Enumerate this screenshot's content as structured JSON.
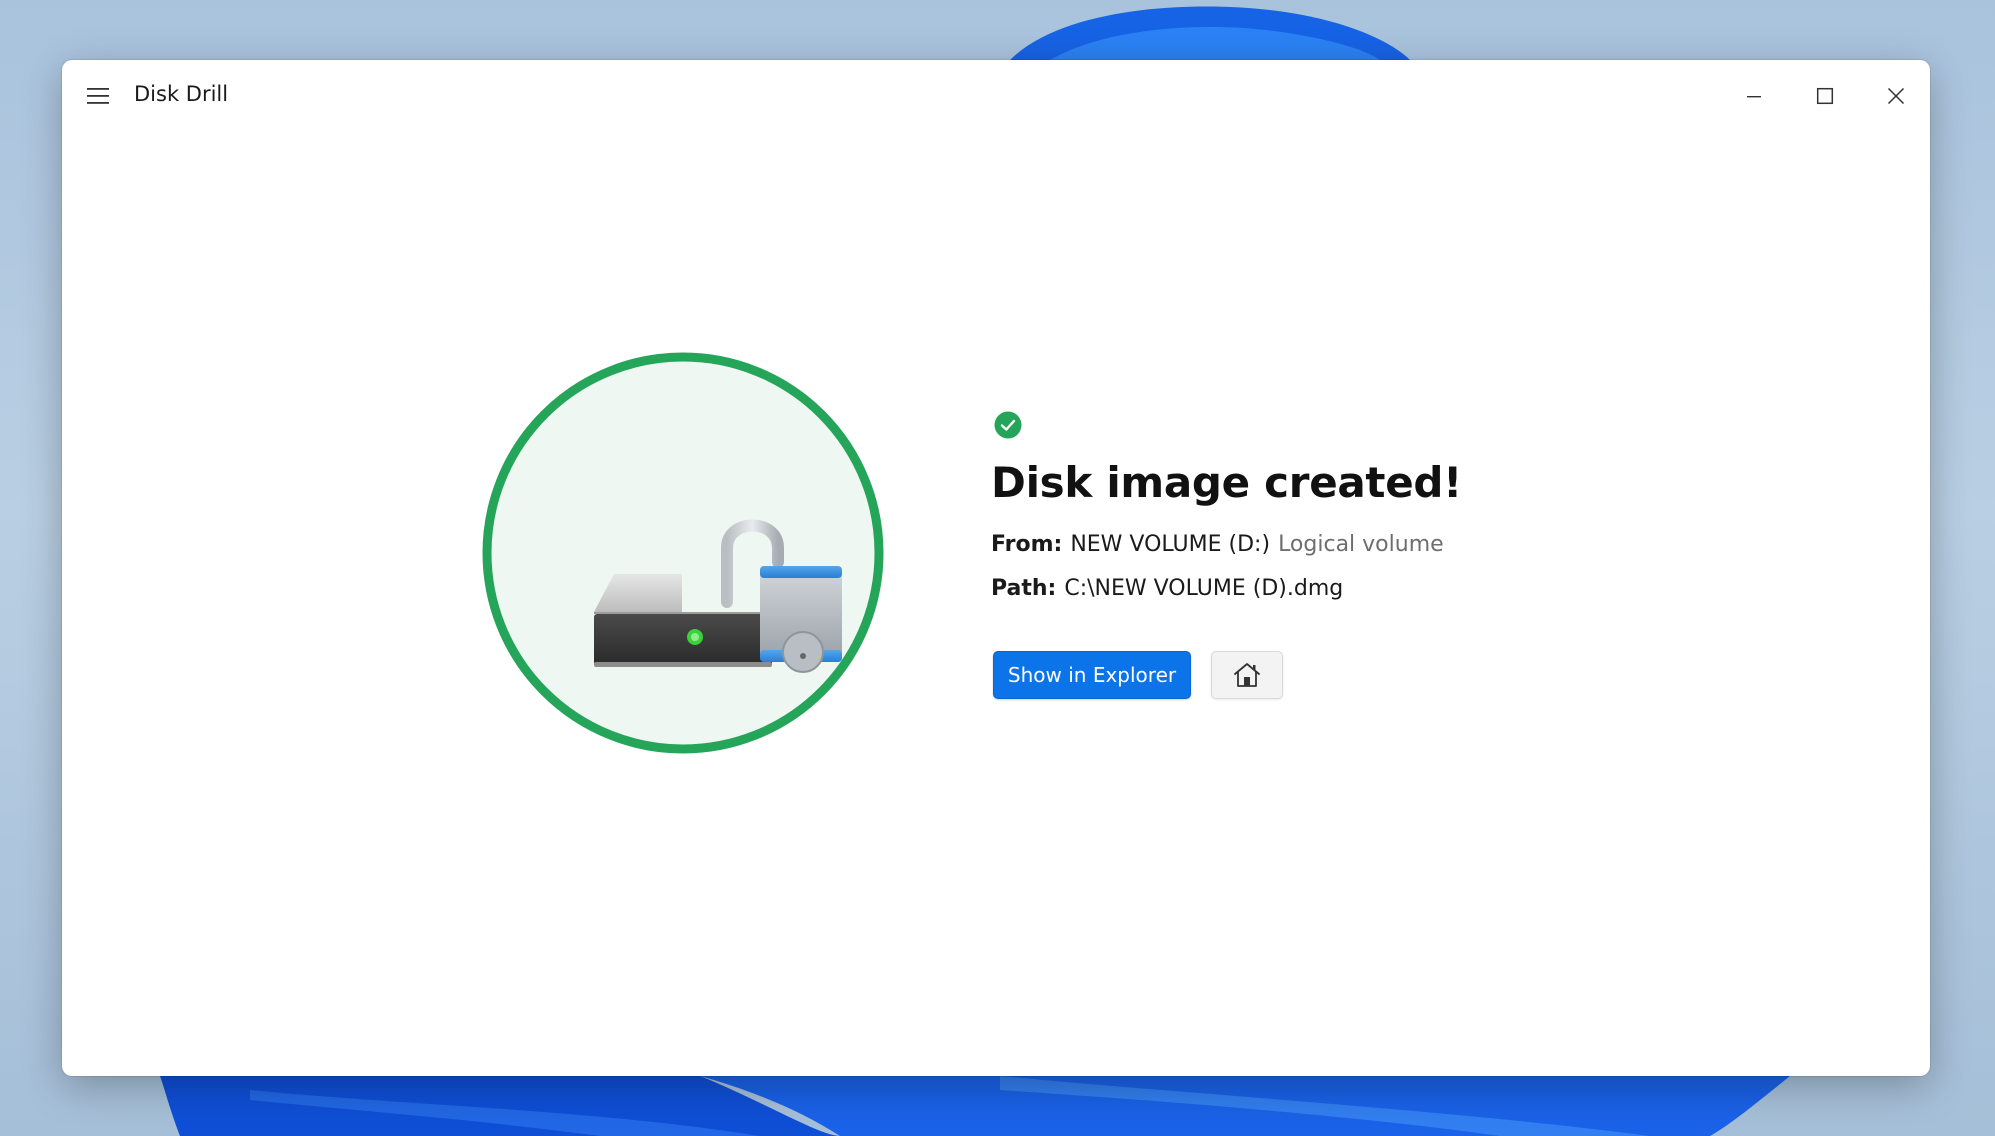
{
  "window": {
    "title": "Disk Drill",
    "controls": {
      "menu_icon": "hamburger-menu-icon",
      "minimize_icon": "minimize-icon",
      "maximize_icon": "maximize-icon",
      "close_icon": "close-icon"
    }
  },
  "result": {
    "status_icon": "success-check-icon",
    "heading": "Disk image created!",
    "from": {
      "label": "From:",
      "value": "NEW VOLUME (D:)",
      "subtitle": "Logical volume"
    },
    "path": {
      "label": "Path:",
      "value": "C:\\NEW VOLUME (D).dmg"
    },
    "illustration_icon": "unlocked-drive-icon"
  },
  "actions": {
    "show_in_explorer": "Show in Explorer",
    "home_icon": "home-icon"
  },
  "colors": {
    "accent": "#0a74e8",
    "success": "#25a559",
    "illustration_bg": "#eff7f2"
  }
}
